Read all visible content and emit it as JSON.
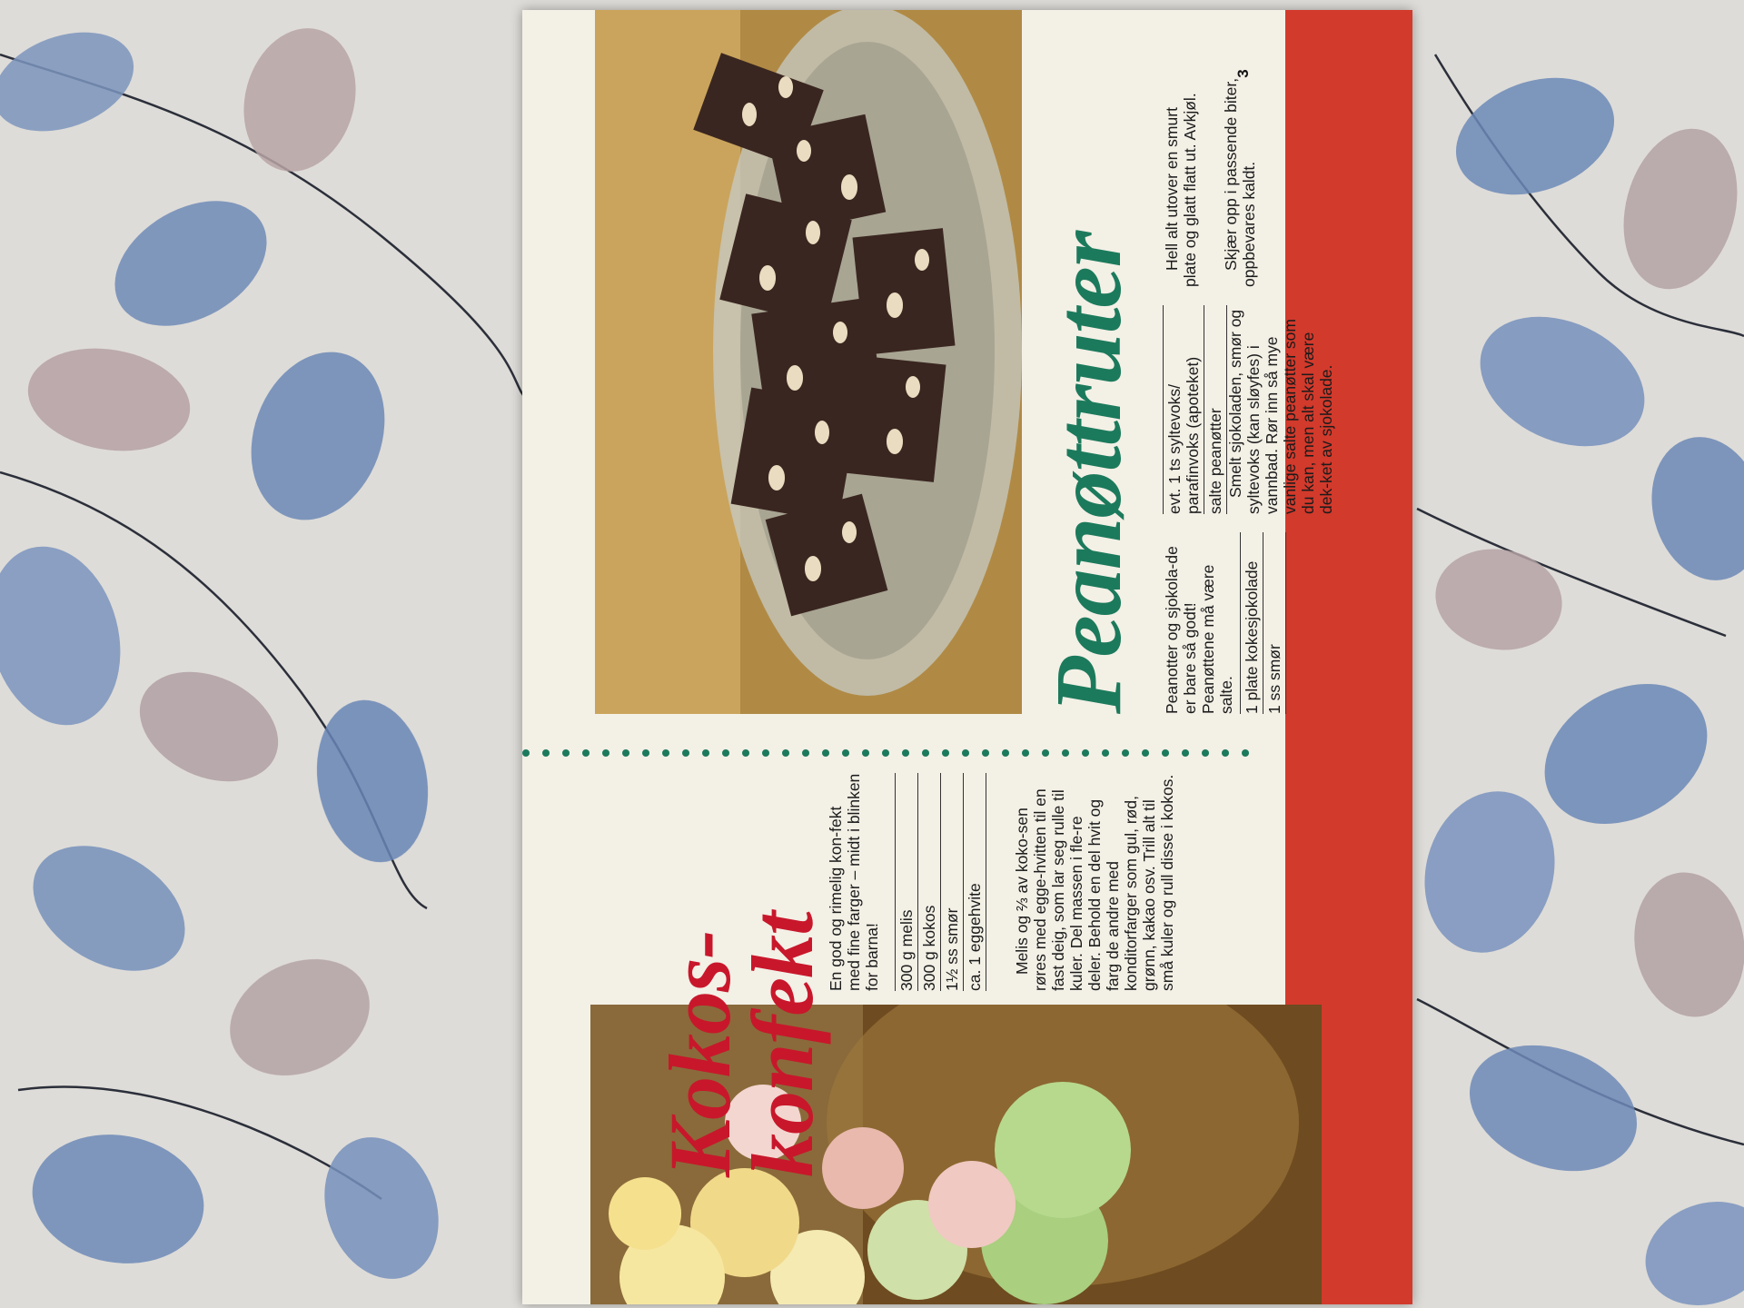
{
  "page_number": "3",
  "kokos": {
    "title_line1": "Kokos-",
    "title_line2": "konfekt",
    "intro": "En god og rimelig kon-fekt med fine farger – midt i blinken for barna!",
    "ingredients": [
      "300 g melis",
      "300 g kokos",
      "1½ ss smør",
      "ca. 1 eggehvite"
    ],
    "method": "Melis og ⅔ av koko-sen røres med egge-hvitten til en fast deig, som lar seg rulle til kuler. Del massen i fle-re deler. Behold en del hvit og farg de andre med konditorfarger som gul, rød, grønn, kakao osv. Trill alt til små kuler og rull disse i kokos."
  },
  "peanut": {
    "title": "Peanøttruter",
    "intro": "Peanotter og sjokola-de er bare så godt! Peanøttene må være salte.",
    "ingredients_a": [
      "1 plate kokesjokolade",
      "1 ss smør"
    ],
    "ingredients_b": [
      "evt. 1 ts syltevoks/ parafinvoks (apoteket)",
      "salte peanøtter"
    ],
    "method_1": "Smelt sjokoladen, smør og syltevoks (kan sløyfes) i vannbad. Rør inn så mye vanlige salte peanøtter som du kan, men alt skal være dek-ket av sjokolade.",
    "method_2": "Hell alt utover en smurt plate og glatt flatt ut. Avkjøl.",
    "method_3": "Skjær opp i passende biter, oppbevares kaldt."
  },
  "colors": {
    "title_red": "#c8172b",
    "title_green": "#1c7a5c",
    "band_red": "#d23a2c",
    "paper": "#f3f0e6"
  }
}
